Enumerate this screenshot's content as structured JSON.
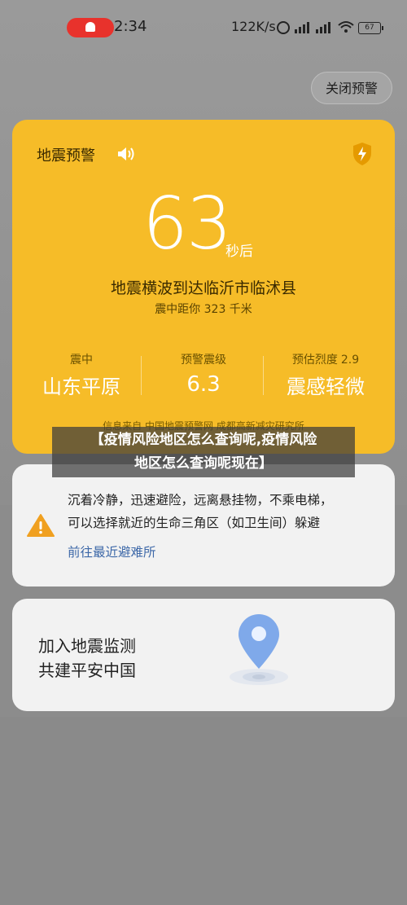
{
  "status_bar": {
    "time": "2:34",
    "network_speed": "122K/s",
    "battery": "67"
  },
  "close_alert_label": "关闭预警",
  "quake_card": {
    "title": "地震预警",
    "countdown": "63",
    "countdown_unit": "秒后",
    "wave_text": "地震横波到达临沂市临沭县",
    "distance_text": "震中距你 323 千米",
    "epicenter_label": "震中",
    "epicenter_value": "山东平原",
    "warning_magnitude_label": "预警震级",
    "warning_magnitude_value": "6.3",
    "intensity_label": "预估烈度",
    "intensity_value_num": "2.9",
    "intensity_value": "震感轻微",
    "source": "信息来自 中国地震预警网 成都高新减灾研究所",
    "card_color": "#f6bc28"
  },
  "banner_lines": [
    "【疫情风险地区怎么查询呢,疫情风险",
    "地区怎么查询呢现在】"
  ],
  "safety_card": {
    "advice_line1": "沉着冷静，迅速避险，远离悬挂物，不乘电梯，",
    "advice_line2": "可以选择就近的生命三角区（如卫生间）躲避",
    "shelter_link": "前往最近避难所"
  },
  "join_card": {
    "line1": "加入地震监测",
    "line2": "共建平安中国"
  },
  "icons": {
    "speaker": "speaker-icon",
    "shield": "shield-lightning-icon",
    "warning": "warning-triangle-icon",
    "pin": "location-pin-icon"
  }
}
